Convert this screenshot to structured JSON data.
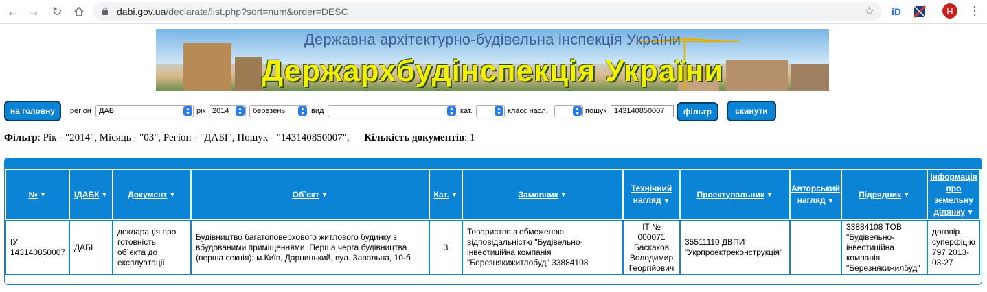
{
  "browser": {
    "url_domain": "dabi.gov.ua",
    "url_path": "/declarate/list.php?sort=num&order=DESC",
    "avatar_letter": "Н"
  },
  "banner": {
    "subtitle": "Державна архітектурно-будівельна інспекція України",
    "title": "Держархбудінспекція України"
  },
  "filter_bar": {
    "home_button": "на головну",
    "region_label": "регіон",
    "region_value": "ДАБІ",
    "year_label": "рік",
    "year_value": "2014",
    "month_value": "березень",
    "type_label": "вид",
    "type_value": "",
    "cat_label": "кат.",
    "cat_value": "",
    "class_label": "класс насл.",
    "class_value": "",
    "search_label": "пошук",
    "search_value": "143140850007",
    "filter_button": "фільтр",
    "reset_button": "скинути"
  },
  "summary": {
    "filter_label": "Фільтр",
    "filter_text": ": Рік - \"2014\", Місяць - \"03\", Регіон - \"ДАБІ\", Пошук - \"143140850007\",",
    "count_label": "Кількість документів",
    "count_text": ": 1"
  },
  "table": {
    "headers": {
      "num": "№",
      "idabk": "ІДАБК",
      "document": "Документ",
      "object": "Об`єкт",
      "cat": "Кат.",
      "customer": "Замовник",
      "tech_line1": "Технічний",
      "tech_line2": "нагляд",
      "designer": "Проектувальник",
      "author_line1": "Авторський",
      "author_line2": "нагляд",
      "contractor": "Підрядник",
      "land_line1": "Інформація",
      "land_line2": "про",
      "land_line3": "земельну",
      "land_line4": "ділянку"
    },
    "row": {
      "num": "ІУ 143140850007",
      "idabk": "ДАБІ",
      "document": "декларація про готовність об`єкта до експлуатації",
      "object": "Будівництво багатоповерхового житлового будинку з вбудованими приміщеннями. Перша черга будівництва (перша секція); м.Київ, Дарницький, вул. Завальна, 10-б",
      "cat": "3",
      "customer": "Товариство з обмеженою відповідальністю \"Будівельно-інвестиційна компанія \"Березнякижитлобуд\" 33884108",
      "tech": "ІТ № 000071 Баскаков Володимир Георгійович",
      "designer": "35511110 ДВПИ \"Укрпроектреконструкція\"",
      "author": "",
      "contractor": "33884108 ТОВ \"Будівельно-інвестиційна компанія \"Березнякижилбуд\"",
      "land": "договір суперфіцію 797 2013-03-27"
    }
  }
}
